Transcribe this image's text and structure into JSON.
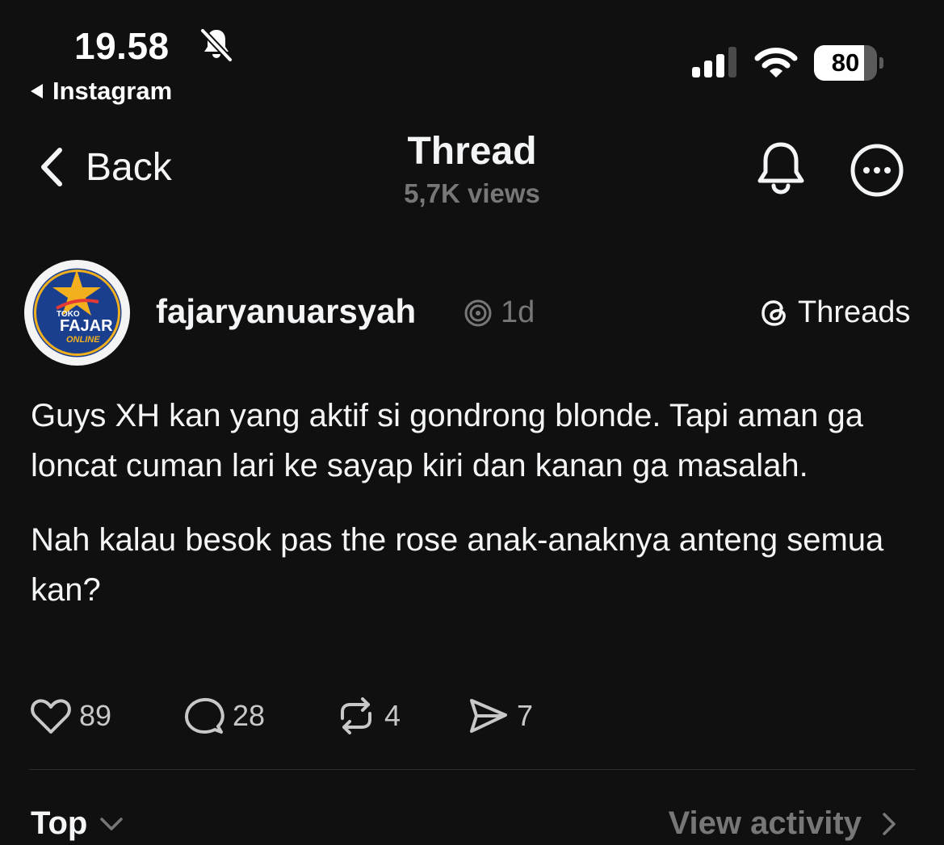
{
  "status_bar": {
    "time": "19.58",
    "back_app": "Instagram",
    "battery_percent": "80",
    "battery_level": 0.8
  },
  "header": {
    "back_label": "Back",
    "title": "Thread",
    "views": "5,7K views"
  },
  "post": {
    "username": "fajaryanuarsyah",
    "age": "1d",
    "source_label": "Threads",
    "avatar_text": [
      "TOKO",
      "FAJAR",
      "ONLINE"
    ],
    "paragraphs": [
      "Guys XH kan yang aktif si gondrong blonde. Tapi aman ga loncat cuman lari ke sayap kiri dan kanan ga masalah.",
      "Nah kalau besok pas the rose anak-anaknya anteng semua kan?"
    ],
    "likes": "89",
    "replies": "28",
    "reposts": "4",
    "shares": "7"
  },
  "footer": {
    "sort_label": "Top",
    "activity_label": "View activity"
  },
  "colors": {
    "background": "#101010",
    "text": "#f3f5f7",
    "muted": "#777777",
    "avatar_blue": "#1b3f8f",
    "avatar_gold": "#f2b01e"
  }
}
